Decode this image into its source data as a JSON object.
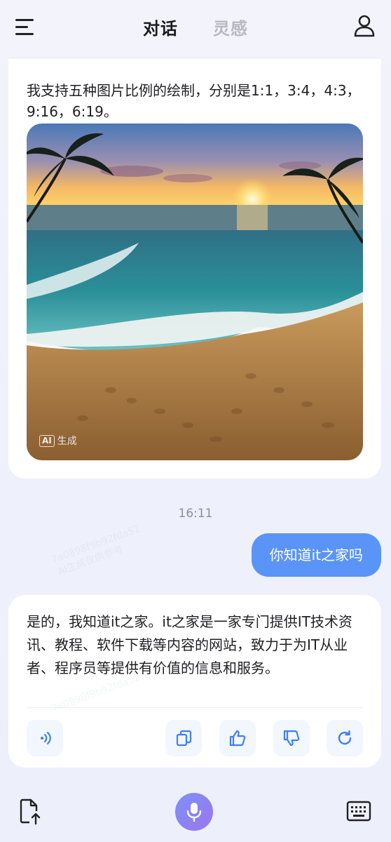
{
  "header": {
    "tabs": [
      {
        "label": "对话",
        "active": true
      },
      {
        "label": "灵感",
        "active": false
      }
    ]
  },
  "messages": {
    "assistant_1": {
      "text": "我支持五种图片比例的绘制，分别是1:1，3:4，4:3，9:16，6:19。",
      "image_badge": {
        "box": "AI",
        "label": "生成"
      }
    },
    "timestamp": "16:11",
    "user_1": {
      "text": "你知道it之家吗"
    },
    "assistant_2": {
      "text": "是的，我知道it之家。it之家是一家专门提供IT技术资讯、教程、软件下载等内容的网站，致力于为IT从业者、程序员等提供有价值的信息和服务。",
      "actions": [
        "speaker-icon",
        "copy-icon",
        "thumbs-up-icon",
        "thumbs-down-icon",
        "refresh-icon"
      ]
    }
  },
  "watermark": {
    "line1": "7a0898f9b92fda52",
    "line2": "AI生成仅供参考"
  },
  "colors": {
    "accent": "#5b94f7",
    "mic_gradient_start": "#7f8ff9",
    "mic_gradient_end": "#9a77ee",
    "action_bg": "#f2f6fd",
    "action_icon": "#3f7ff2"
  },
  "bottom_bar": {
    "icons": [
      "upload-file-icon",
      "microphone-icon",
      "keyboard-icon"
    ]
  }
}
